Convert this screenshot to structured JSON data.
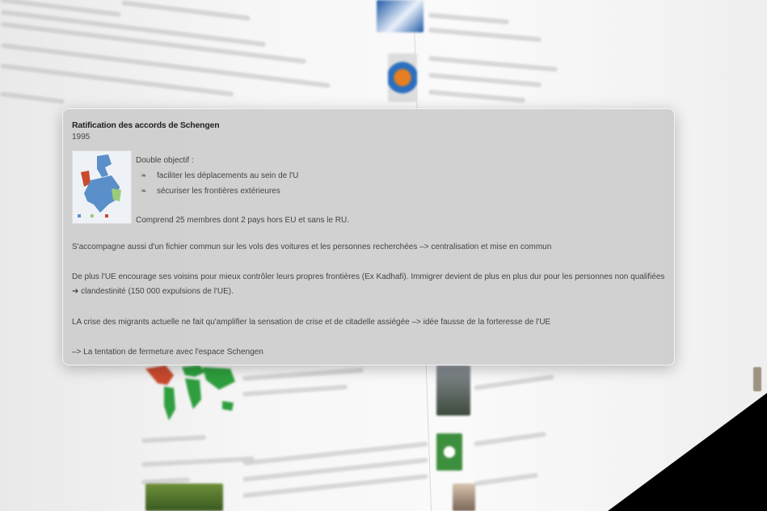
{
  "popup": {
    "title": "Ratification des accords de Schengen",
    "year": "1995",
    "objective_heading": "Double objectif :",
    "bullets": [
      "faciliter les déplacements au sein de l'U",
      "sécuriser les frontières extérieures"
    ],
    "bullet_glyph": "❧",
    "members_text": "Comprend 25 membres dont 2 pays hors EU et sans le RU.",
    "paragraph_1": "S'accompagne aussi d'un fichier commun sur les vols des voitures et les personnes recherchées –> centralisation et mise en commun",
    "paragraph_2": "De plus l'UE encourage ses voisins pour mieux contrôler leurs propres frontières (Ex Kadhafi). Immigrer devient de plus en plus dur pour les personnes non qualifiées ➔ clandestinité (150 000 expulsions de l'UE).",
    "paragraph_3": "LA crise des migrants actuelle ne fait qu'amplifier la sensation de crise et de citadelle assiégée –> idée fausse de la forteresse de l'UE",
    "paragraph_4": "–> La tentation de fermeture avec l'espace Schengen"
  },
  "colors": {
    "popup_bg": "#cdcdcd",
    "map_blue": "#5b8fc9",
    "map_green": "#2e9e3e",
    "map_red": "#c94a2e"
  }
}
